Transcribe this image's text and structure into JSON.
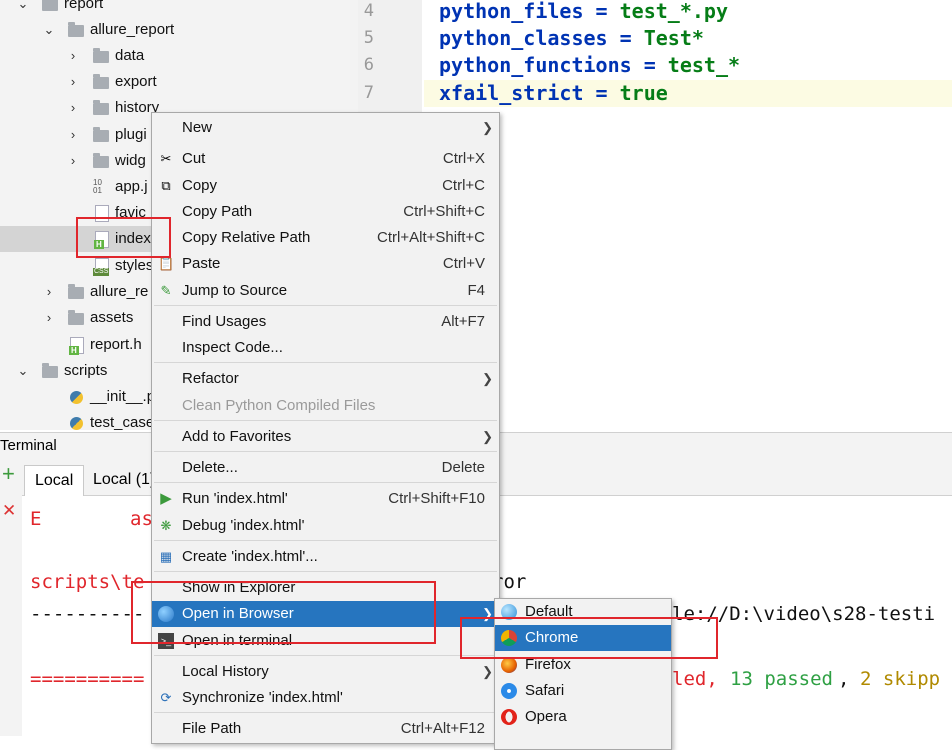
{
  "project_tree": {
    "items": [
      {
        "label": "report",
        "arrow": "⌄"
      },
      {
        "label": "allure_report",
        "arrow": "⌄"
      },
      {
        "label": "data",
        "arrow": "›"
      },
      {
        "label": "export",
        "arrow": "›"
      },
      {
        "label": "history",
        "arrow": "›"
      },
      {
        "label": "plugi",
        "arrow": "›"
      },
      {
        "label": "widg",
        "arrow": "›"
      },
      {
        "label": "app.j",
        "arrow": ""
      },
      {
        "label": "favic",
        "arrow": ""
      },
      {
        "label": "index",
        "arrow": ""
      },
      {
        "label": "styles",
        "arrow": ""
      },
      {
        "label": "allure_re",
        "arrow": "›"
      },
      {
        "label": "assets",
        "arrow": "›"
      },
      {
        "label": "report.h",
        "arrow": ""
      },
      {
        "label": "scripts",
        "arrow": "⌄"
      },
      {
        "label": "__init__.p",
        "arrow": ""
      },
      {
        "label": "test_case",
        "arrow": ""
      }
    ]
  },
  "editor": {
    "lines": [
      {
        "num": "4",
        "key": "python_files",
        "eq": " = ",
        "val": "test_*.py"
      },
      {
        "num": "5",
        "key": "python_classes",
        "eq": " = ",
        "val": "Test*"
      },
      {
        "num": "6",
        "key": "python_functions",
        "eq": " = ",
        "val": "test_*"
      },
      {
        "num": "7",
        "key": "xfail_strict",
        "eq": " = ",
        "val": "true"
      }
    ]
  },
  "terminal": {
    "title": "Terminal",
    "tabs": [
      "Local",
      "Local (1)"
    ],
    "add_icon": "+",
    "close_icon": "✕",
    "lines": {
      "l1a": "E",
      "l1b": "as",
      "l2": "scripts\\te",
      "l2b": "ror",
      "l3": "----------",
      "l3b": "le://D:\\video\\s28-testi",
      "l4": "==========",
      "l4a": "led, ",
      "l4b": "13 passed",
      "l4c": ", ",
      "l4d": "2 skipp"
    }
  },
  "context_menu": {
    "new": "New",
    "cut": "Cut",
    "cut_sc": "Ctrl+X",
    "copy": "Copy",
    "copy_sc": "Ctrl+C",
    "copy_path": "Copy Path",
    "copy_path_sc": "Ctrl+Shift+C",
    "copy_rel": "Copy Relative Path",
    "copy_rel_sc": "Ctrl+Alt+Shift+C",
    "paste": "Paste",
    "paste_sc": "Ctrl+V",
    "jump": "Jump to Source",
    "jump_sc": "F4",
    "find_usages": "Find Usages",
    "find_usages_sc": "Alt+F7",
    "inspect": "Inspect Code...",
    "refactor": "Refactor",
    "clean": "Clean Python Compiled Files",
    "favorites": "Add to Favorites",
    "delete": "Delete...",
    "delete_sc": "Delete",
    "run": "Run 'index.html'",
    "run_sc": "Ctrl+Shift+F10",
    "debug": "Debug 'index.html'",
    "create": "Create 'index.html'...",
    "show_explorer": "Show in Explorer",
    "open_browser": "Open in Browser",
    "open_terminal": "Open in terminal",
    "local_history": "Local History",
    "synchronize": "Synchronize 'index.html'",
    "file_path": "File Path",
    "file_path_sc": "Ctrl+Alt+F12"
  },
  "browser_menu": {
    "items": [
      "Default",
      "Chrome",
      "Firefox",
      "Safari",
      "Opera"
    ]
  },
  "colors": {
    "highlight": "#2675bf",
    "annotation": "#e0262c",
    "keyword": "#0033b3",
    "value": "#067d17",
    "error": "#e0262c"
  }
}
